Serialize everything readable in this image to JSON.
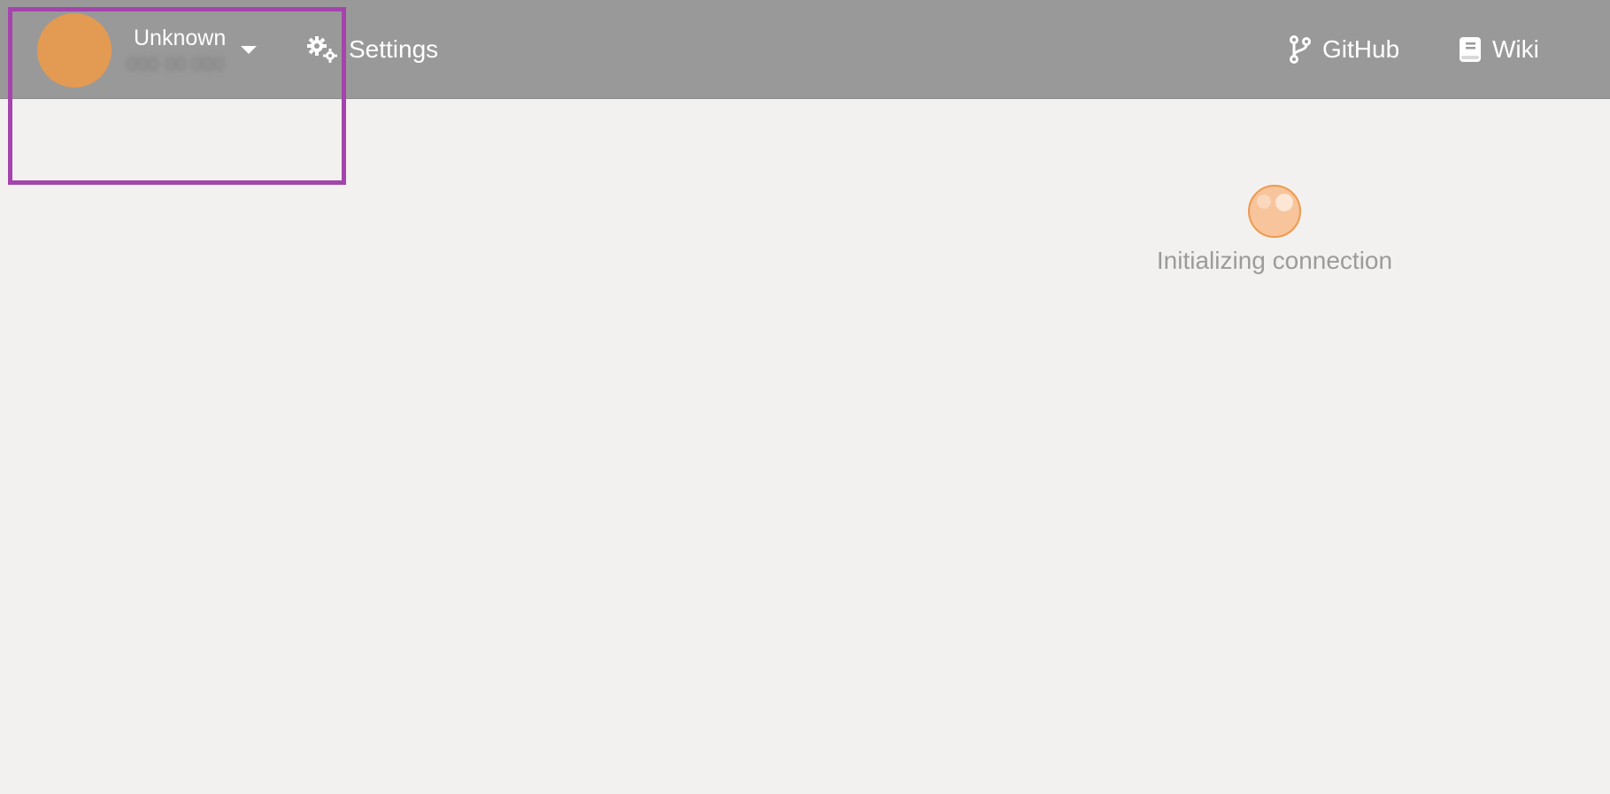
{
  "header": {
    "user": {
      "name": "Unknown",
      "detail": "000 00 000"
    },
    "nav": {
      "settings_label": "Settings",
      "github_label": "GitHub",
      "wiki_label": "Wiki"
    },
    "icons": {
      "avatar": "avatar",
      "dropdown": "caret-down-icon",
      "settings": "gears-icon",
      "github": "code-branch-icon",
      "wiki": "book-icon"
    }
  },
  "main": {
    "status_text": "Initializing connection"
  },
  "colors": {
    "header_bg": "#999999",
    "page_bg": "#f3f1ef",
    "avatar": "#e39a52",
    "highlight": "#a444ac",
    "spinner": "#f7c49b",
    "spinner_border": "#ee9a4d"
  }
}
